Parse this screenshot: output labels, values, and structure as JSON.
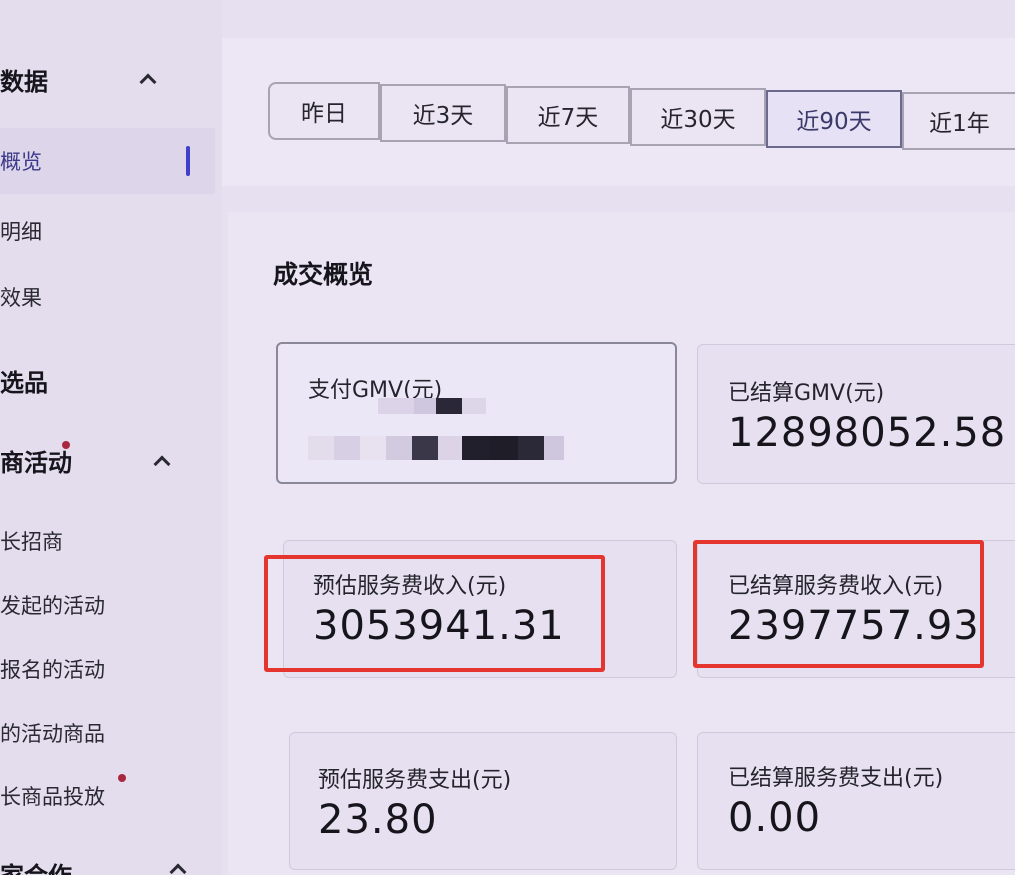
{
  "sidebar": {
    "groups": [
      {
        "label": "数据"
      },
      {
        "label": "选品"
      },
      {
        "label": "商活动"
      },
      {
        "label": "家合作"
      }
    ],
    "items": [
      {
        "label": "概览"
      },
      {
        "label": "明细"
      },
      {
        "label": "效果"
      },
      {
        "label": "长招商"
      },
      {
        "label": "发起的活动"
      },
      {
        "label": "报名的活动"
      },
      {
        "label": "的活动商品"
      },
      {
        "label": "长商品投放"
      }
    ]
  },
  "date_filter": {
    "options": [
      "昨日",
      "近3天",
      "近7天",
      "近30天",
      "近90天",
      "近1年"
    ],
    "selected": "近90天"
  },
  "overview": {
    "title": "成交概览",
    "cards": [
      {
        "label": "支付GMV(元)",
        "value": ""
      },
      {
        "label": "已结算GMV(元)",
        "value": "12898052.58"
      },
      {
        "label": "预估服务费收入(元)",
        "value": "3053941.31"
      },
      {
        "label": "已结算服务费收入(元)",
        "value": "2397757.93"
      },
      {
        "label": "预估服务费支出(元)",
        "value": "23.80"
      },
      {
        "label": "已结算服务费支出(元)",
        "value": "0.00"
      }
    ]
  },
  "colors": {
    "annotation": "#e5352f",
    "active_indicator": "#3f3fc9",
    "notification_dot": "#a8283f"
  }
}
